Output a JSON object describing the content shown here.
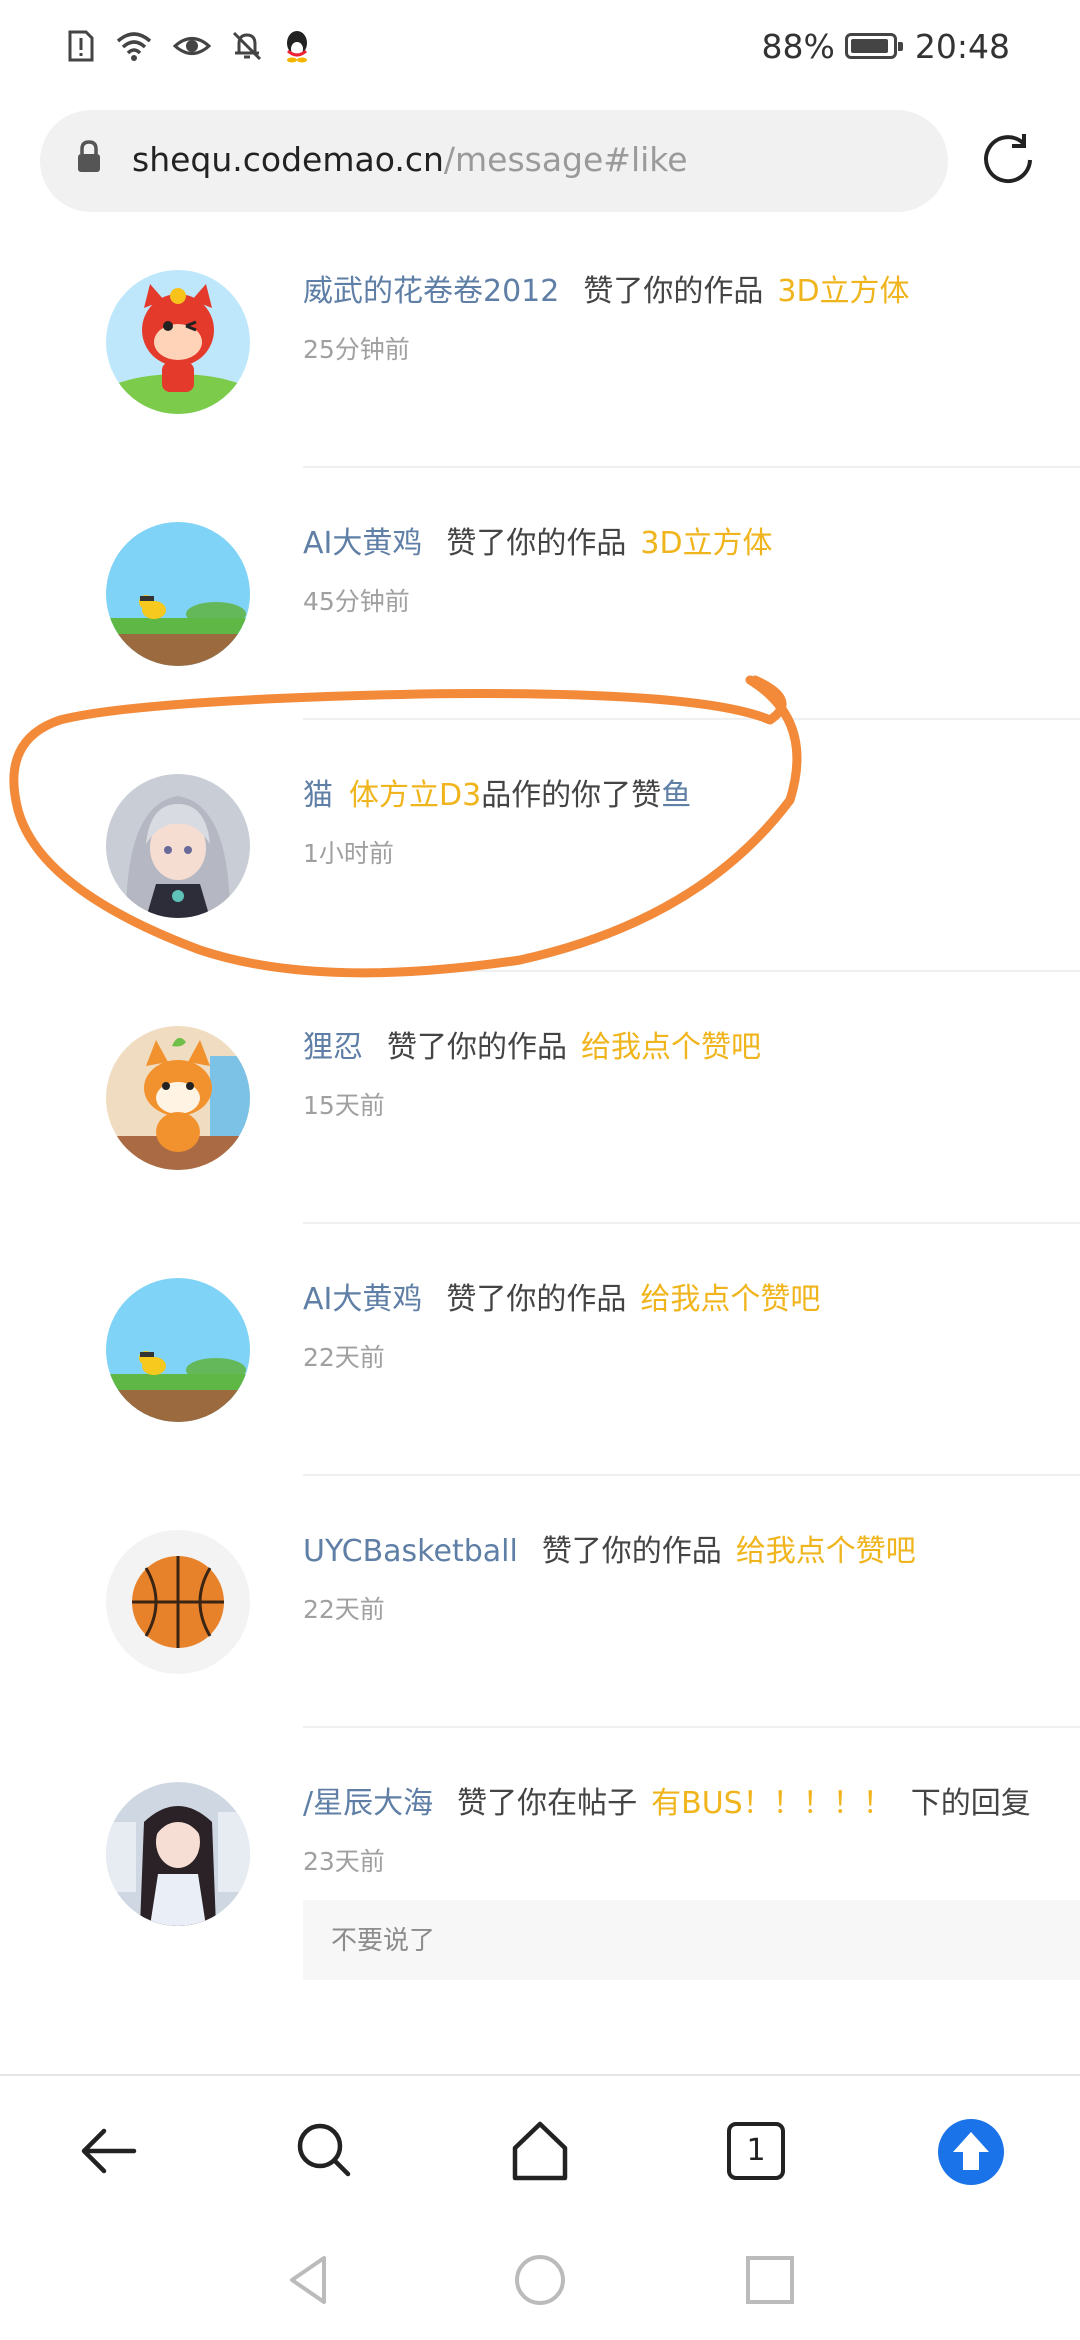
{
  "status_bar": {
    "battery_text": "88%",
    "battery_level": 0.88,
    "time": "20:48",
    "icons": [
      "sim-alert-icon",
      "wifi-icon",
      "eye-icon",
      "bell-off-icon",
      "qq-penguin-icon"
    ]
  },
  "address_bar": {
    "host": "shequ.codemao.cn",
    "path": "/message#like",
    "lock_icon": "lock-icon",
    "reload_icon": "reload-icon"
  },
  "messages": [
    {
      "user": "威武的花卷卷2012",
      "verb": "赞了你的作品",
      "work": "3D立方体",
      "time": "25分钟前",
      "avatar": "red-cat-mascot"
    },
    {
      "user": "AI大黄鸡",
      "verb": "赞了你的作品",
      "work": "3D立方体",
      "time": "45分钟前",
      "avatar": "yellow-chick-scene"
    },
    {
      "user_end": "猫",
      "work_reversed": "体方立D3",
      "verb_reversed": "品作的你了赞",
      "user_start": "鱼",
      "time": "1小时前",
      "avatar": "anime-girl-silver-hair"
    },
    {
      "user": "狸忍",
      "verb": "赞了你的作品",
      "work": "给我点个赞吧",
      "time": "15天前",
      "avatar": "orange-fox-mascot"
    },
    {
      "user": "AI大黄鸡",
      "verb": "赞了你的作品",
      "work": "给我点个赞吧",
      "time": "22天前",
      "avatar": "yellow-chick-scene"
    },
    {
      "user": "UYCBasketball",
      "verb": "赞了你的作品",
      "work": "给我点个赞吧",
      "time": "22天前",
      "avatar": "basketball"
    },
    {
      "user": "/星辰大海",
      "verb": "赞了你在帖子",
      "work": "有BUS！！！！！",
      "suffix": "下的回复",
      "time": "23天前",
      "reply": "不要说了",
      "avatar": "anime-girl-dark-hair"
    }
  ],
  "toolbar": {
    "icons": [
      "back-arrow-icon",
      "search-icon",
      "home-icon",
      "tabs-icon",
      "upload-icon"
    ],
    "tab_count": "1"
  },
  "colors": {
    "username": "#5f7fa6",
    "work_title": "#f0b41c",
    "annotation": "#f28a3a",
    "upload_button": "#1a73e8"
  }
}
